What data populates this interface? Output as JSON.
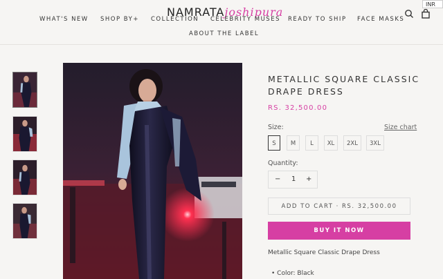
{
  "header": {
    "logo_part1": "NAMRATA",
    "logo_part2": "joshipura",
    "currency": "INR",
    "nav": [
      "WHAT'S NEW",
      "SHOP BY+",
      "COLLECTION",
      "CELEBRITY MUSES",
      "READY TO SHIP",
      "FACE MASKS",
      "ABOUT THE LABEL"
    ]
  },
  "icons": {
    "search": "search-icon",
    "cart": "shopping-bag-icon"
  },
  "product": {
    "title": "METALLIC SQUARE CLASSIC DRAPE DRESS",
    "price": "RS. 32,500.00",
    "size_label": "Size:",
    "size_chart": "Size chart",
    "sizes": [
      "S",
      "M",
      "L",
      "XL",
      "2XL",
      "3XL"
    ],
    "selected_size": "S",
    "quantity_label": "Quantity:",
    "quantity": "1",
    "minus": "−",
    "plus": "+",
    "add_to_cart": "ADD TO CART  ·  RS. 32,500.00",
    "buy_now": "BUY IT NOW",
    "description": "Metallic Square Classic Drape Dress",
    "features": [
      "Color: Black"
    ]
  },
  "colors": {
    "accent": "#d63fa3",
    "text": "#333333",
    "background": "#f6f5f3"
  }
}
